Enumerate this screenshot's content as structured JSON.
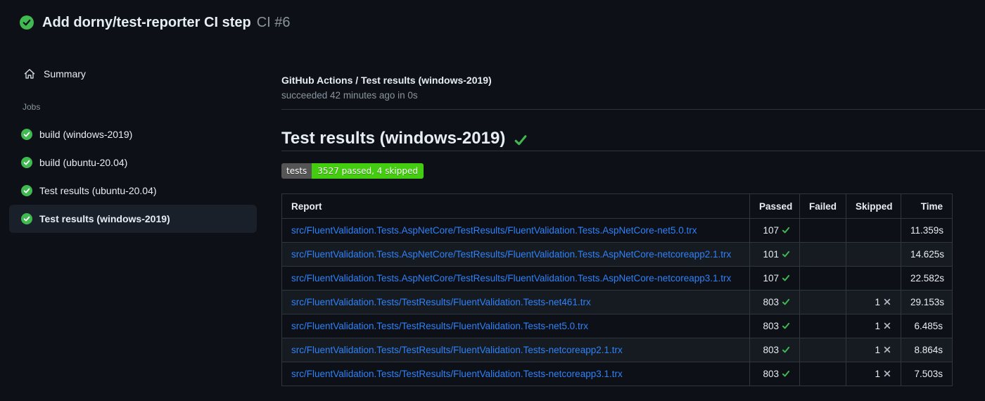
{
  "header": {
    "title": "Add dorny/test-reporter CI step",
    "run_number": "CI #6",
    "status_icon": "check-circle-icon"
  },
  "sidebar": {
    "summary_label": "Summary",
    "summary_icon": "home-icon",
    "jobs_label": "Jobs",
    "jobs": [
      {
        "label": "build (windows-2019)",
        "status_icon": "check-circle-icon",
        "selected": false
      },
      {
        "label": "build (ubuntu-20.04)",
        "status_icon": "check-circle-icon",
        "selected": false
      },
      {
        "label": "Test results (ubuntu-20.04)",
        "status_icon": "check-circle-icon",
        "selected": false
      },
      {
        "label": "Test results (windows-2019)",
        "status_icon": "check-circle-icon",
        "selected": true
      }
    ]
  },
  "main": {
    "check_run_title": "GitHub Actions / Test results (windows-2019)",
    "check_run_status": "succeeded 42 minutes ago in 0s",
    "section_title": "Test results (windows-2019)",
    "section_status_icon": "check-icon",
    "badge": {
      "label": "tests",
      "value": "3527 passed, 4 skipped",
      "label_bg": "#555555",
      "value_bg": "#44cc11"
    },
    "table": {
      "columns": [
        "Report",
        "Passed",
        "Failed",
        "Skipped",
        "Time"
      ],
      "rows": [
        {
          "report": "src/FluentValidation.Tests.AspNetCore/TestResults/FluentValidation.Tests.AspNetCore-net5.0.trx",
          "passed": "107",
          "failed": "",
          "skipped": "",
          "time": "11.359s"
        },
        {
          "report": "src/FluentValidation.Tests.AspNetCore/TestResults/FluentValidation.Tests.AspNetCore-netcoreapp2.1.trx",
          "passed": "101",
          "failed": "",
          "skipped": "",
          "time": "14.625s"
        },
        {
          "report": "src/FluentValidation.Tests.AspNetCore/TestResults/FluentValidation.Tests.AspNetCore-netcoreapp3.1.trx",
          "passed": "107",
          "failed": "",
          "skipped": "",
          "time": "22.582s"
        },
        {
          "report": "src/FluentValidation.Tests/TestResults/FluentValidation.Tests-net461.trx",
          "passed": "803",
          "failed": "",
          "skipped": "1",
          "time": "29.153s"
        },
        {
          "report": "src/FluentValidation.Tests/TestResults/FluentValidation.Tests-net5.0.trx",
          "passed": "803",
          "failed": "",
          "skipped": "1",
          "time": "6.485s"
        },
        {
          "report": "src/FluentValidation.Tests/TestResults/FluentValidation.Tests-netcoreapp2.1.trx",
          "passed": "803",
          "failed": "",
          "skipped": "1",
          "time": "8.864s"
        },
        {
          "report": "src/FluentValidation.Tests/TestResults/FluentValidation.Tests-netcoreapp3.1.trx",
          "passed": "803",
          "failed": "",
          "skipped": "1",
          "time": "7.503s"
        }
      ]
    }
  },
  "colors": {
    "page_bg": "#0d1117",
    "row_alt_bg": "#161b22",
    "border": "#30363d",
    "success_green": "#3fb950",
    "link_blue": "#2f81f7",
    "muted_text": "#8b949e",
    "skipped_x_gray": "#b1bac4"
  }
}
